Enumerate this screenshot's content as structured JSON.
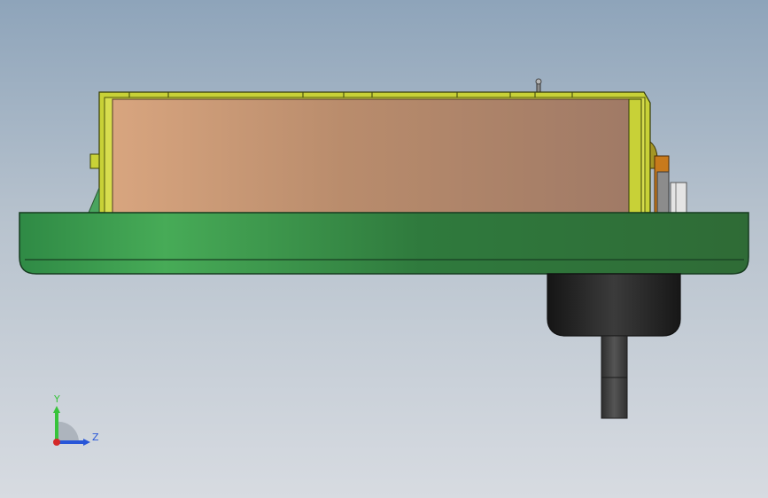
{
  "viewport": {
    "background_top": "#8ea4ba",
    "background_bottom": "#d7dbe1"
  },
  "model": {
    "housing_color": "#c8d137",
    "body_gradient_left": "#d8a57f",
    "body_gradient_right": "#a37d68",
    "base_color": "#2f8a45",
    "knob_color": "#1c1c1c",
    "shaft_color": "#4a4a4a",
    "bracket_color": "#c87a1c"
  },
  "triad": {
    "y_label": "Y",
    "z_label": "Z",
    "y_color": "#37c33a",
    "z_color": "#2856d8",
    "x_color": "#d42828"
  }
}
